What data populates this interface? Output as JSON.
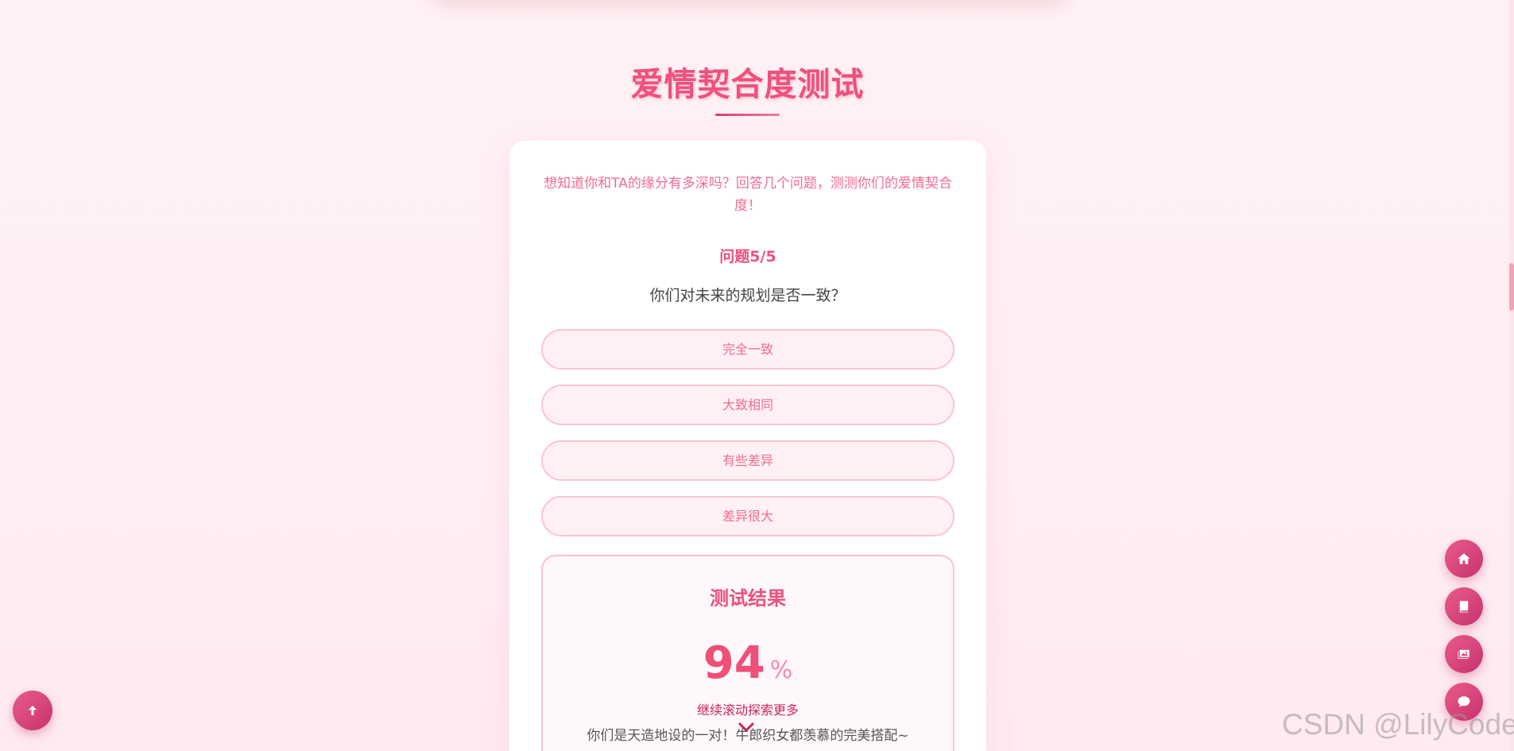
{
  "section": {
    "title": "爱情契合度测试"
  },
  "quiz": {
    "intro": "想知道你和TA的缘分有多深吗？回答几个问题，测测你们的爱情契合度！",
    "counter": "问题5/5",
    "question": "你们对未来的规划是否一致？",
    "options": [
      "完全一致",
      "大致相同",
      "有些差异",
      "差异很大"
    ]
  },
  "result": {
    "title": "测试结果",
    "score": "94",
    "unit": "%",
    "scroll_hint": "继续滚动探索更多",
    "description": "你们是天造地设的一对！牛郎织女都羡慕的完美搭配~"
  },
  "fabs": {
    "home": "home-icon",
    "book": "book-icon",
    "photo": "photo-icon",
    "chat": "chat-icon",
    "top": "arrow-up-icon"
  },
  "watermark": "CSDN @LilyCoder",
  "colors": {
    "accent": "#f0507c",
    "accent_dark": "#c8336e",
    "option_border": "#fbc3d1",
    "option_bg": "#fff0f4",
    "background": "#fff1f4"
  }
}
